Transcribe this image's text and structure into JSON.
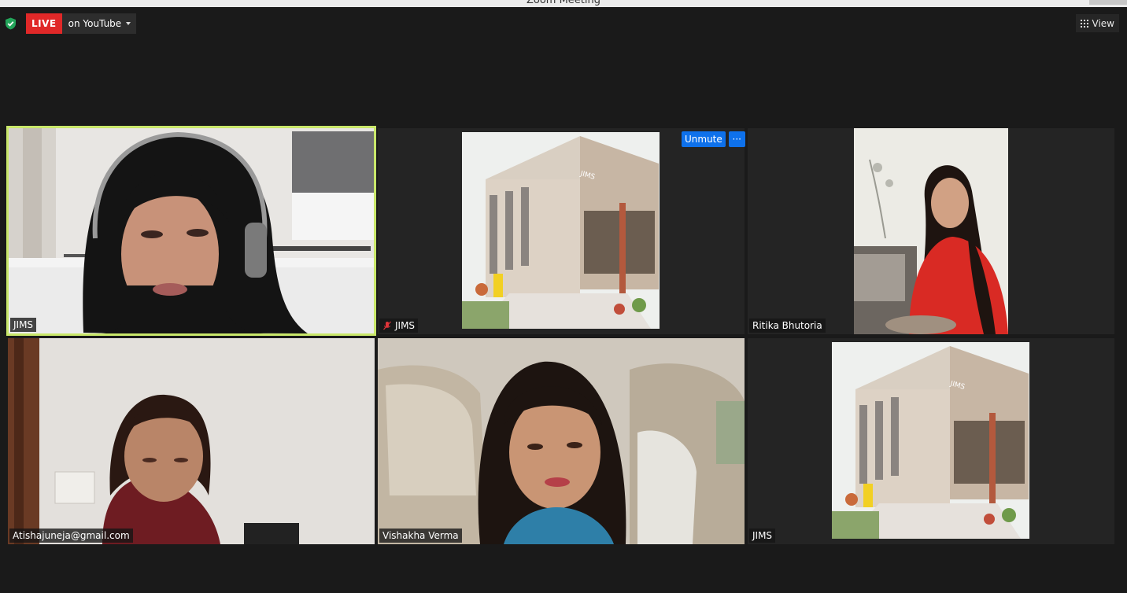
{
  "window": {
    "title": "Zoom Meeting"
  },
  "header": {
    "live_badge": "LIVE",
    "live_target": "on YouTube",
    "view_label": "View"
  },
  "controls": {
    "unmute_label": "Unmute",
    "more_label": "···"
  },
  "participants": [
    {
      "name": "JIMS",
      "active_speaker": true,
      "muted": false
    },
    {
      "name": "JIMS",
      "active_speaker": false,
      "muted": true
    },
    {
      "name": "Ritika Bhutoria",
      "active_speaker": false,
      "muted": false
    },
    {
      "name": "Atishajuneja@gmail.com",
      "active_speaker": false,
      "muted": false
    },
    {
      "name": "Vishakha Verma",
      "active_speaker": false,
      "muted": false
    },
    {
      "name": "JIMS",
      "active_speaker": false,
      "muted": false
    }
  ],
  "colors": {
    "active_border": "#c9e76a",
    "live_red": "#e02828",
    "unmute_blue": "#0e71eb",
    "shield_green": "#23a55a",
    "muted_red": "#e0353a"
  }
}
